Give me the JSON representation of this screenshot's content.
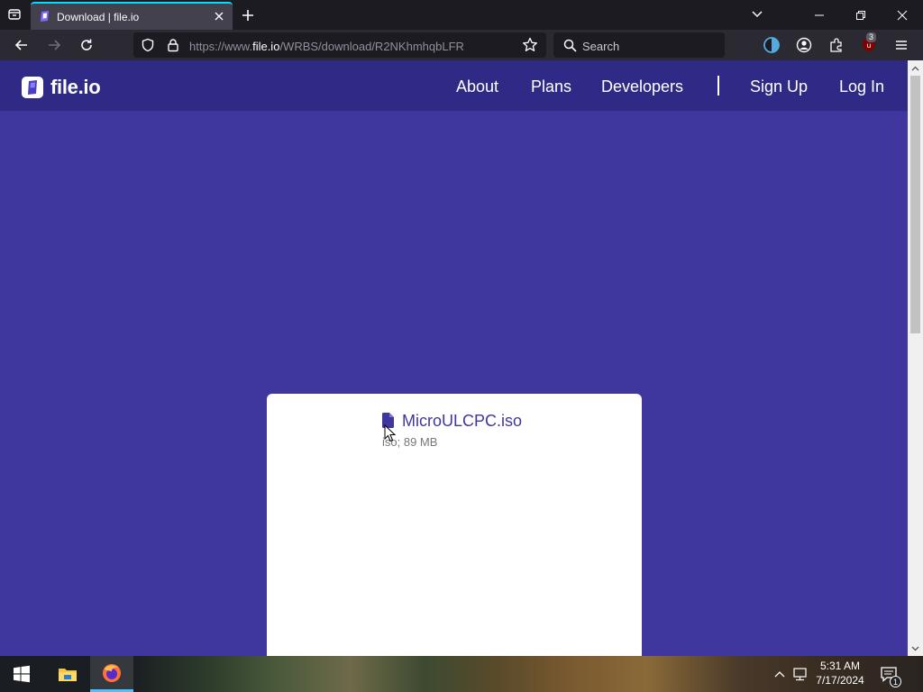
{
  "browser": {
    "tab": {
      "title": "Download | file.io"
    },
    "address": {
      "prefix": "https://www.",
      "host": "file.io",
      "path": "/WRBS/download/R2NKhmhqbLFR"
    },
    "search": {
      "placeholder": "Search"
    },
    "extension_badge": "3"
  },
  "site": {
    "logo_text": "file.io",
    "nav": [
      {
        "label": "About"
      },
      {
        "label": "Plans"
      },
      {
        "label": "Developers"
      },
      {
        "label": "Sign Up"
      },
      {
        "label": "Log In"
      }
    ]
  },
  "file": {
    "name": "MicroULCPC.iso",
    "meta": "iso; 89 MB"
  },
  "taskbar": {
    "time": "5:31 AM",
    "date": "7/17/2024",
    "notification_count": "1"
  },
  "colors": {
    "page_background": "#3f379e",
    "header_background": "#2f2a85",
    "accent": "#3f379e"
  }
}
